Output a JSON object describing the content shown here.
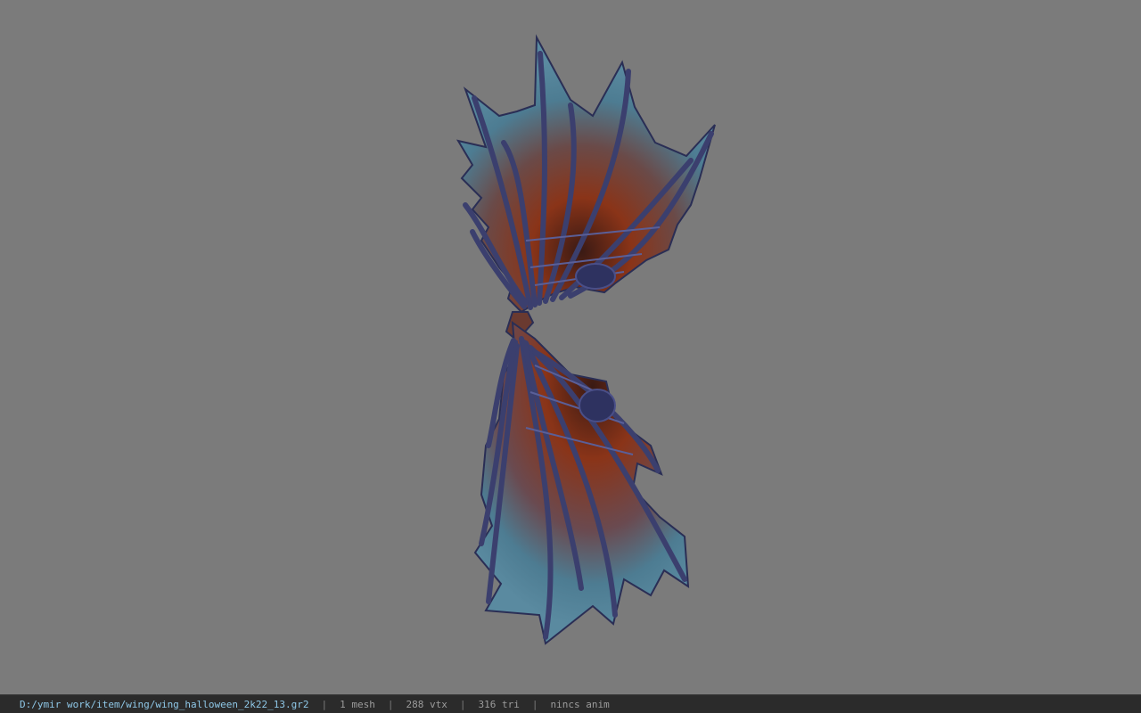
{
  "status_bar": {
    "file_path": "D:/ymir work/item/wing/wing_halloween_2k22_13.gr2",
    "separator": "|",
    "mesh_count": "1 mesh",
    "vertex_count": "288 vtx",
    "triangle_count": "316 tri",
    "anim_status": "nincs anim"
  },
  "colors": {
    "viewport_bg": "#7b7b7b",
    "status_bg": "#2b2b2b",
    "path_text": "#8fc8e8",
    "stat_text": "#9c9c9c",
    "wing_membrane_blue": "#4d7c92",
    "wing_membrane_red": "#8a3418",
    "wing_bone": "#3b3f6e"
  }
}
